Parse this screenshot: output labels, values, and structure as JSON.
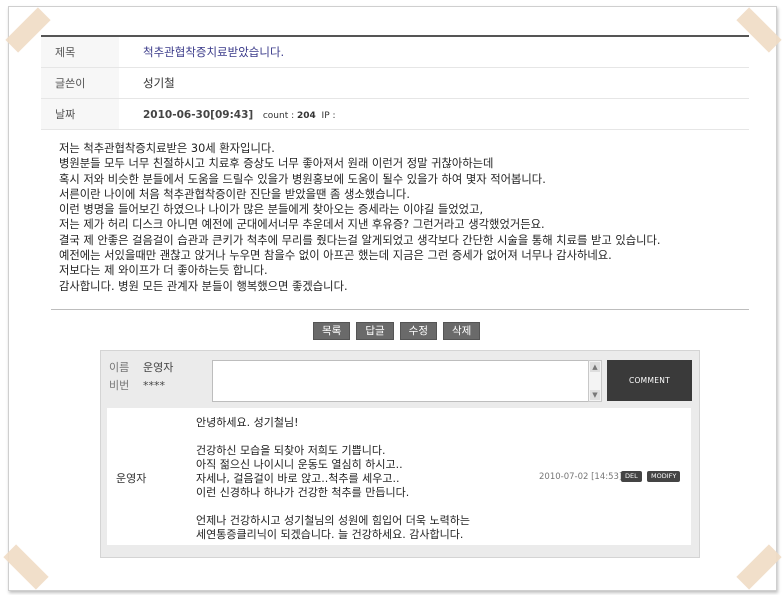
{
  "post": {
    "subject_label": "제목",
    "subject": "척추관협착증치료받았습니다.",
    "author_label": "글쓴이",
    "author": "성기철",
    "date_label": "날짜",
    "date": "2010-06-30[09:43]",
    "count_label": "count :",
    "count": "204",
    "ip_label": "IP :"
  },
  "body_lines": [
    "저는 척추관협착증치료받은 30세 환자입니다.",
    "병원분들 모두 너무 친절하시고 치료후 증상도 너무 좋아져서 원래 이런거 정말 귀찮아하는데",
    "혹시 저와 비슷한 분들에서 도움을 드릴수 있을가 병원홍보에 도움이 될수 있을가 하여 몇자 적어봅니다.",
    "서른이란 나이에 처음 척추관협착증이란 진단을 받았을땐 좀 생소했습니다.",
    "이런 병명을 들어보긴 하였으나 나이가 많은 분들에게 찾아오는 증세라는 이야길 들었었고,",
    "저는 제가 허리 디스크 아니면 예전에 군대에서너무 추운데서 지낸 후유증? 그런거라고 생각했었거든요.",
    "결국 제 안좋은 걸음걸이 습관과 큰키가 척추에 무리를 줬다는걸 알게되었고 생각보다 간단한 시술을 통해 치료를 받고 있습니다.",
    "예전에는 서있을때만 괜찮고 앉거나 누우면 참을수 없이 아프곤 했는데 지금은 그런 증세가 없어져 너무나 감사하네요.",
    "저보다는 제 와이프가 더 좋아하는듯 합니다.",
    "감사합니다. 병원 모든 관계자 분들이 행복했으면 좋겠습니다."
  ],
  "buttons": {
    "list": "목록",
    "reply": "답글",
    "edit": "수정",
    "delete": "삭제"
  },
  "comment_form": {
    "name_label": "이름",
    "name_value": "운영자",
    "password_label": "비번",
    "password_value": "****",
    "textarea_value": "",
    "submit_label": "COMMENT"
  },
  "comment": {
    "author": "운영자",
    "lines": [
      "안녕하세요. 성기철님!",
      "",
      "건강하신 모습을 되찾아 저희도 기쁩니다.",
      "아직 젊으신 나이시니 운동도 열심히 하시고..",
      "자세나, 걸음걸이 바로 앉고..척추를 세우고..",
      "이런 신경하나 하나가 건강한 척추를 만듭니다.",
      "",
      "언제나 건강하시고 성기철님의 성원에 힘입어 더욱 노력하는",
      "세연통증클리닉이 되겠습니다. 늘 건강하세요. 감사합니다."
    ],
    "date": "2010-07-02 [14:53]",
    "del_label": "DEL",
    "modify_label": "MODIFY"
  },
  "colors": {
    "subject": "#3b3b8a",
    "button_bg": "#6a6a6a",
    "comment_button_bg": "#3a3a3a",
    "tape": "#efdcc4"
  }
}
